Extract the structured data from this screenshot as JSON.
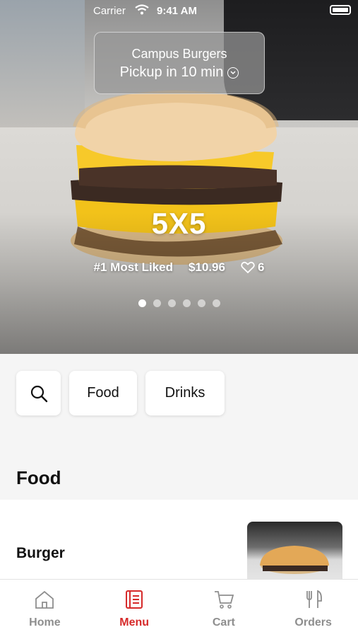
{
  "status_bar": {
    "carrier": "Carrier",
    "time": "9:41 AM"
  },
  "store": {
    "name": "Campus Burgers",
    "pickup": "Pickup in 10 min"
  },
  "hero": {
    "title": "5X5",
    "badge": "#1 Most Liked",
    "price": "$10.96",
    "likes": "6",
    "slide_count": 6,
    "active_slide": 0
  },
  "filters": {
    "search_icon": "search-icon",
    "food": "Food",
    "drinks": "Drinks"
  },
  "section": {
    "title": "Food"
  },
  "items": [
    {
      "name": "Burger"
    }
  ],
  "tabs": [
    {
      "label": "Home",
      "icon": "home-icon"
    },
    {
      "label": "Menu",
      "icon": "menu-icon",
      "active": true
    },
    {
      "label": "Cart",
      "icon": "cart-icon"
    },
    {
      "label": "Orders",
      "icon": "orders-icon"
    }
  ],
  "colors": {
    "accent": "#d62a2a",
    "inactive": "#8e8e8e",
    "background": "#f5f5f5"
  }
}
